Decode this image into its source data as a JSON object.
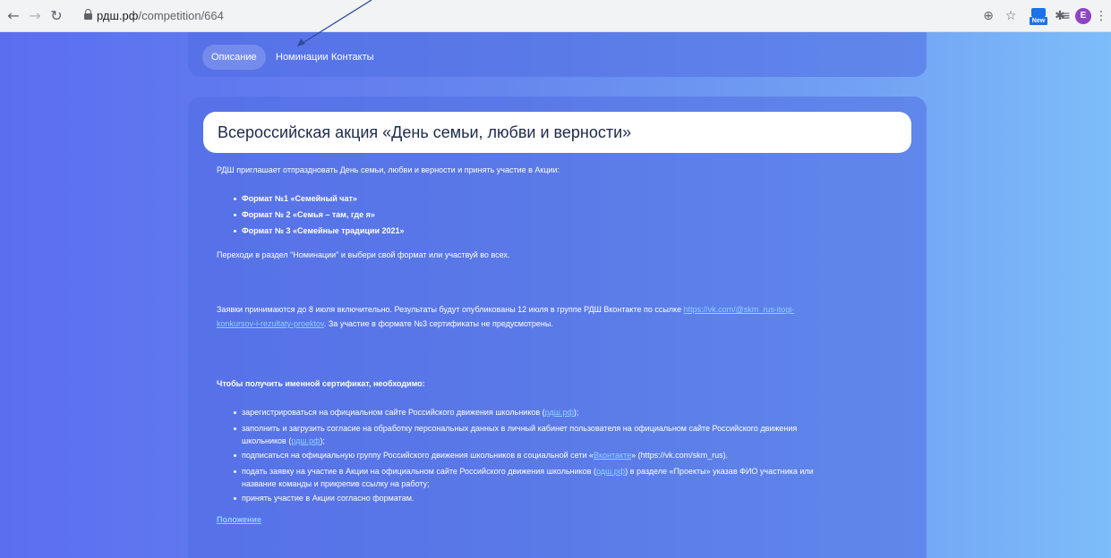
{
  "browser": {
    "url_host": "рдш.рф",
    "url_path": "/competition/664",
    "avatar_letter": "E",
    "ext_new_label": "New"
  },
  "tabs": [
    {
      "label": "Описание",
      "active": true
    },
    {
      "label": "Номинации",
      "active": false
    },
    {
      "label": "Контакты",
      "active": false
    }
  ],
  "content": {
    "title": "Всероссийская акция «День семьи, любви и верности»",
    "intro": "РДШ приглашает отпраздновать День семьи, любви и верности и принять участие в Акции:",
    "formats": [
      "Формат №1 «Семейный чат»",
      "Формат № 2 «Семья – там, где я»",
      "Формат № 3 «Семейные традиции 2021»"
    ],
    "go_to": "Переходи в раздел \"Номинации\" и выбери свой формат или участвуй во всех.",
    "deadline_line1_text": "Заявки принимаются до 8 июля включительно. Результаты будут опубликованы 12 июля в группе РДШ Вконтакте по ссылке ",
    "deadline_line1_link": "https://vk.com/@skm_rus-itogi-",
    "deadline_line2_link": "konkursov-i-rezultaty-proektov",
    "deadline_line2_text": ". За участие в формате №3 сертификаты не предусмотрены.",
    "cert_heading": "Чтобы получить именной сертификат, необходимо:",
    "steps": {
      "s1_text": "зарегистрироваться на официальном сайте Российского движения школьников (",
      "s1_link": "рдш.рф",
      "s1_tail": ");",
      "s2_text": "заполнить и загрузить согласие на обработку персональных данных в личный кабинет пользователя на официальном сайте Российского движения",
      "s2_line2": "школьников (",
      "s2_link": "рдш.рф",
      "s2_tail": ");",
      "s3_text": "подписаться на официальную группу Российского движения школьников в социальной сети «",
      "s3_link": "Вконтакте",
      "s3_tail": "» (https://vk.com/skm_rus).",
      "s4_text": "подать заявку на участие в Акции на официальном сайте Российского движения школьников (",
      "s4_link": "рдш.рф",
      "s4_tail": ") в разделе «Проекты» указав ФИО участника или",
      "s4_line2": "название команды и прикрепив ссылку на работу;",
      "s5_text": "принять участие в Акции согласно форматам."
    },
    "regulation_link": "Положение"
  }
}
